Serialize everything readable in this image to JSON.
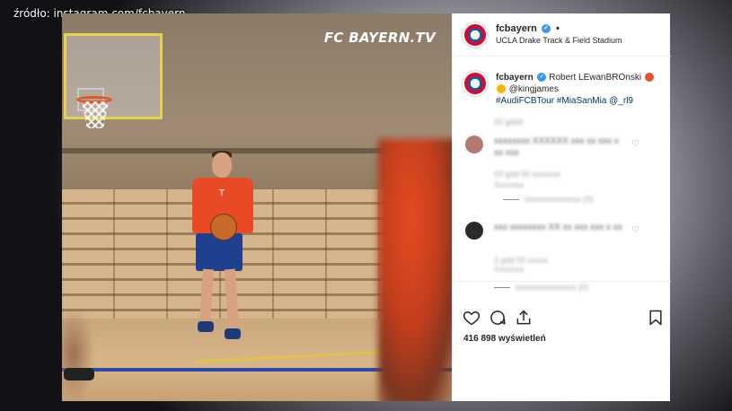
{
  "source": {
    "caption": "źródło: instagram.com/fcbayern"
  },
  "video": {
    "watermark": "FC BAYERN.TV"
  },
  "post": {
    "username": "fcbayern",
    "header_dot": "•",
    "location": "UCLA Drake Track & Field Stadium",
    "caption": {
      "username": "fcbayern",
      "line1": "Robert LEwanBROnski",
      "mention": "@kingjames",
      "hashtags": "#AudiFCBTour #MiaSanMia @_rl9"
    },
    "views": "416 898 wyświetleń"
  },
  "icons": {
    "verified": "verified-badge-icon",
    "like": "heart-icon",
    "comment": "comment-icon",
    "share": "share-icon",
    "save": "bookmark-icon"
  },
  "colors": {
    "bayern_red": "#dc052d",
    "instagram_blue": "#3897f0",
    "hashtag": "#003569",
    "text": "#262626"
  }
}
